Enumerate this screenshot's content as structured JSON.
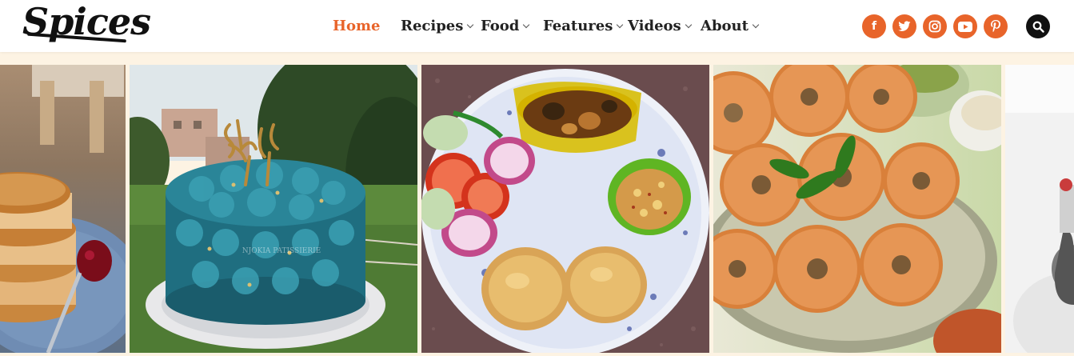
{
  "brand": {
    "logo_text": "Spices"
  },
  "nav": {
    "items": [
      {
        "label": "Home",
        "active": true,
        "has_dropdown": false
      },
      {
        "label": "Recipes",
        "active": false,
        "has_dropdown": true
      },
      {
        "label": "Food",
        "active": false,
        "has_dropdown": true
      },
      {
        "label": "Features",
        "active": false,
        "has_dropdown": true
      },
      {
        "label": "Videos",
        "active": false,
        "has_dropdown": true
      },
      {
        "label": "About",
        "active": false,
        "has_dropdown": true
      }
    ]
  },
  "social": [
    {
      "icon": "facebook-icon",
      "glyph": "f"
    },
    {
      "icon": "twitter-icon",
      "glyph": "t"
    },
    {
      "icon": "instagram-icon",
      "glyph": "◎"
    },
    {
      "icon": "youtube-icon",
      "glyph": "▶"
    },
    {
      "icon": "pinterest-icon",
      "glyph": "p"
    }
  ],
  "search": {
    "icon": "search-icon"
  },
  "slides": [
    {
      "subject": "pancakes",
      "icon": "pancakes-image"
    },
    {
      "subject": "cake",
      "icon": "cake-image",
      "watermark": "NJOKIA PATISSIERIE"
    },
    {
      "subject": "curry-plate",
      "icon": "curry-plate-image"
    },
    {
      "subject": "vada",
      "icon": "vada-image"
    },
    {
      "subject": "partial",
      "icon": "partial-image"
    }
  ],
  "colors": {
    "accent": "#e8642a",
    "dark": "#111111",
    "page_bg": "#fdf3e3"
  }
}
